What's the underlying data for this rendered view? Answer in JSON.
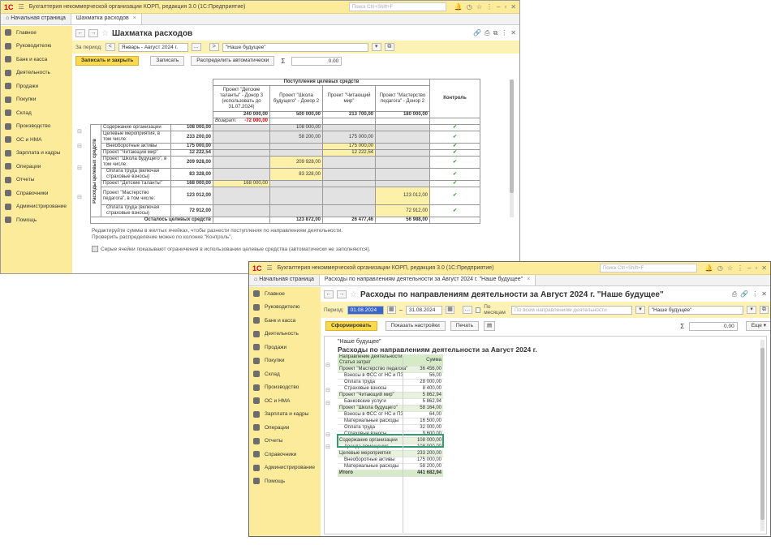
{
  "colors": {
    "accent": "#fbeb9a",
    "primary_button": "#fbd94a",
    "yellow_cell": "#fdf0a8",
    "grey_cell": "#e2e2e2",
    "check": "#3aa23a",
    "negative": "#d00000",
    "report_header": "#d5ebc8"
  },
  "app": {
    "title": "Бухгалтерия некоммерческой организации КОРП, редакция 3.0  (1С:Предприятие)",
    "search_placeholder": "Поиск Ctrl+Shift+F"
  },
  "sidebar": {
    "items": [
      {
        "label": "Главное",
        "icon": "menu-icon"
      },
      {
        "label": "Руководителю",
        "icon": "chart-icon"
      },
      {
        "label": "Банк и касса",
        "icon": "bank-icon"
      },
      {
        "label": "Деятельность",
        "icon": "activity-icon"
      },
      {
        "label": "Продажи",
        "icon": "sales-icon"
      },
      {
        "label": "Покупки",
        "icon": "cart-icon"
      },
      {
        "label": "Склад",
        "icon": "warehouse-icon"
      },
      {
        "label": "Производство",
        "icon": "factory-icon"
      },
      {
        "label": "ОС и НМА",
        "icon": "assets-icon"
      },
      {
        "label": "Зарплата и кадры",
        "icon": "people-icon"
      },
      {
        "label": "Операции",
        "icon": "operations-icon"
      },
      {
        "label": "Отчеты",
        "icon": "reports-icon"
      },
      {
        "label": "Справочники",
        "icon": "book-icon"
      },
      {
        "label": "Администрирование",
        "icon": "gear-icon"
      },
      {
        "label": "Помощь",
        "icon": "help-icon"
      }
    ]
  },
  "window1": {
    "tab_home": "Начальная страница",
    "tab_active": "Шахматка расходов",
    "form_title": "Шахматка расходов",
    "period_label": "За период:",
    "period_value": "Январь - Август 2024 г.",
    "ellipsis": "...",
    "org_value": "\"Наше будущее\"",
    "btn_save_close": "Записать и закрыть",
    "btn_save": "Записать",
    "btn_distribute": "Распределить автоматически",
    "sigma": "Σ",
    "sum_value": "0.00",
    "table": {
      "receipts_header": "Поступления целевых средств",
      "control_header": "Контроль",
      "projects": [
        {
          "name": "Проект \"Детские таланты\" - Донор 3 (использовать до 31.07.2024)",
          "amount": "240 000,00"
        },
        {
          "name": "Проект \"Школа будущего\" - Донор 2",
          "amount": "500 000,00"
        },
        {
          "name": "Проект \"Читающий мир\"",
          "amount": "213 700,00"
        },
        {
          "name": "Проект \"Мастерство педагога\" - Донор 2",
          "amount": "180 000,00"
        }
      ],
      "return_label": "Возврат:",
      "return_value": "-72 000,00",
      "side_label": "Расходы целевых средств",
      "rows": [
        {
          "label": "Содержание организации",
          "total": "108 000,00",
          "p1": "",
          "p2": "108 000,00",
          "p3": "",
          "p4": ""
        },
        {
          "label": "Целевые мероприятия, в том числе:",
          "total": "233 200,00",
          "p1": "",
          "p2": "58 200,00",
          "p3": "175 000,00",
          "p4": ""
        },
        {
          "label": "Внеоборотные активы",
          "total": "175 000,00",
          "p1": "",
          "p2": "",
          "p3": "175 000,00",
          "p4": ""
        },
        {
          "label": "Проект \"Читающий мир\"",
          "total": "12 222,54",
          "p1": "",
          "p2": "",
          "p3": "12 222,54",
          "p4": ""
        },
        {
          "label": "Проект \"Школа будущего\", в том числе:",
          "total": "209 928,00",
          "p1": "",
          "p2": "209 928,00",
          "p3": "",
          "p4": ""
        },
        {
          "label": "Оплата труда (включая страховые взносы)",
          "total": "83 328,00",
          "p1": "",
          "p2": "83 328,00",
          "p3": "",
          "p4": ""
        },
        {
          "label": "Проект \"Детские таланты\"",
          "total": "168 000,00",
          "p1": "168 000,00",
          "p2": "",
          "p3": "",
          "p4": ""
        },
        {
          "label": "Проект \"Мастерство педагога\", в том числе:",
          "total": "123 012,00",
          "p1": "",
          "p2": "",
          "p3": "",
          "p4": "123 012,00"
        },
        {
          "label": "Оплата труда (включая страховые взносы)",
          "total": "72 912,00",
          "p1": "",
          "p2": "",
          "p3": "",
          "p4": "72 912,00"
        }
      ],
      "remaining_label": "Осталось целевых средств",
      "remaining": {
        "p2": "123 872,00",
        "p3": "26 477,46",
        "p4": "56 988,00"
      }
    },
    "hint_line1": "Редактируйте суммы в желтых ячейках, чтобы разнести поступления по направлениям деятельности.",
    "hint_line2": "Проверить распределение можно по колонке \"Контроль\".",
    "grey_note": "Серые ячейки показывают ограничения в использовании целевые средства (автоматически не заполняются)."
  },
  "window2": {
    "tab_home": "Начальная страница",
    "tab_active": "Расходы по направлениям деятельности за Август 2024 г. \"Наше будущее\"",
    "form_title": "Расходы по направлениям деятельности за Август 2024 г. \"Наше будущее\"",
    "period_label": "Период:",
    "date_from": "01.08.2024",
    "dash": "–",
    "date_to": "31.08.2024",
    "by_months": "По месяцам",
    "directions_placeholder": "По всем направлениям деятельности",
    "org_value": "\"Наше будущее\"",
    "btn_generate": "Сформировать",
    "btn_settings": "Показать настройки",
    "btn_print": "Печать",
    "sigma": "Σ",
    "sum_value": "0,00",
    "btn_more": "Еще",
    "report": {
      "org": "\"Наше будущее\"",
      "title": "Расходы по направлениям деятельности за Август 2024 г.",
      "head_col1_line1": "Направление деятельности",
      "head_col1_line2": "Статья затрат",
      "head_col2": "Сумма",
      "rows": [
        {
          "label": "Проект \"Мастерство педагога\"",
          "value": "36 456,00",
          "level": 0
        },
        {
          "label": "Взносы в ФСС от НС и ПЗ",
          "value": "56,00",
          "level": 1
        },
        {
          "label": "Оплата труда",
          "value": "28 000,00",
          "level": 1
        },
        {
          "label": "Страховые взносы",
          "value": "8 400,00",
          "level": 1
        },
        {
          "label": "Проект \"Читающий мир\"",
          "value": "5 862,94",
          "level": 0
        },
        {
          "label": "Банковские услуги",
          "value": "5 862,94",
          "level": 1
        },
        {
          "label": "Проект \"Школа будущего\"",
          "value": "58 164,00",
          "level": 0
        },
        {
          "label": "Взносы в ФСС от НС и ПЗ",
          "value": "64,00",
          "level": 1
        },
        {
          "label": "Материальные расходы",
          "value": "16 500,00",
          "level": 1
        },
        {
          "label": "Оплата труда",
          "value": "32 000,00",
          "level": 1
        },
        {
          "label": "Страховые взносы",
          "value": "9 600,00",
          "level": 1
        },
        {
          "label": "Содержание организации",
          "value": "108 000,00",
          "level": 0
        },
        {
          "label": "Аренда помещения",
          "value": "108 000,00",
          "level": 1
        },
        {
          "label": "Целевые мероприятия",
          "value": "233 200,00",
          "level": 0
        },
        {
          "label": "Внеоборотные активы",
          "value": "175 000,00",
          "level": 1
        },
        {
          "label": "Материальные расходы",
          "value": "58 200,00",
          "level": 1
        }
      ],
      "total_label": "Итого",
      "total_value": "441 682,94"
    }
  }
}
